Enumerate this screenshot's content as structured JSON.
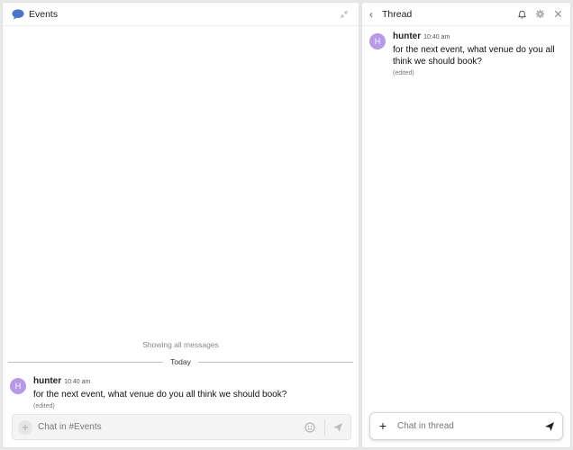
{
  "channel": {
    "title": "Events",
    "showing_all": "Showing all messages",
    "day_label": "Today",
    "message": {
      "avatar": "H",
      "author": "hunter",
      "time": "10:40 am",
      "text": "for the next event, what venue do you all think we should book?",
      "edited": "(edited)"
    },
    "composer": {
      "placeholder": "Chat in #Events"
    }
  },
  "thread": {
    "title": "Thread",
    "message": {
      "avatar": "H",
      "author": "hunter",
      "time": "10:40 am",
      "text": "for the next event, what venue do you all think we should book?",
      "edited": "(edited)"
    },
    "composer": {
      "placeholder": "Chat in thread"
    }
  },
  "colors": {
    "accent": "#4a74c9",
    "avatar": "#b799e6"
  }
}
